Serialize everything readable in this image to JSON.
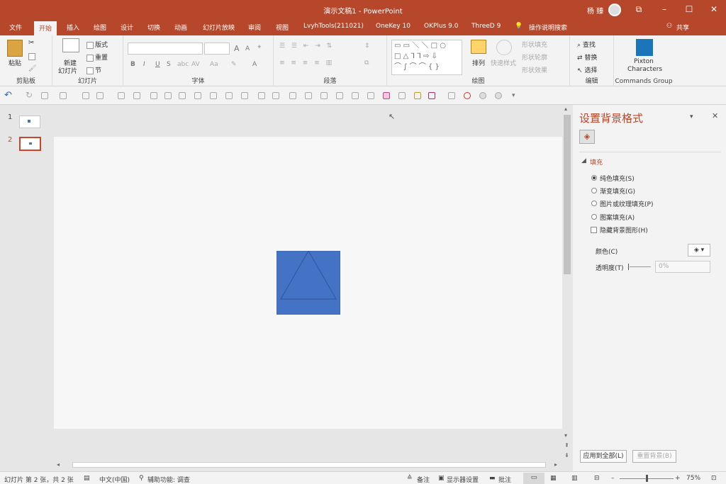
{
  "window": {
    "title": "演示文稿1 - PowerPoint",
    "user": "杨 臻",
    "min": "–",
    "max": "☐",
    "close": "✕",
    "ribbon_display": "⧉"
  },
  "tabs": [
    "文件",
    "开始",
    "插入",
    "绘图",
    "设计",
    "切换",
    "动画",
    "幻灯片放映",
    "审阅",
    "视图",
    "LvyhTools(211021)",
    "OneKey 10",
    "OKPlus 9.0",
    "ThreeD 9",
    "操作说明搜索"
  ],
  "share": "共享",
  "ribbon": {
    "clipboard": {
      "paste": "粘贴",
      "label": "剪贴板"
    },
    "slides": {
      "new_slide_1": "新建",
      "new_slide_2": "幻灯片",
      "layout": "版式",
      "reset": "重置",
      "section": "节",
      "label": "幻灯片"
    },
    "font": {
      "label": "字体",
      "grow": "A",
      "shrink": "A",
      "bold": "B",
      "italic": "I",
      "underline": "U",
      "strike": "S",
      "spacing": "abc",
      "case": "Aa",
      "color": "A"
    },
    "paragraph": {
      "label": "段落"
    },
    "drawing": {
      "arrange": "排列",
      "quick_styles": "快速样式",
      "shape_fill": "形状填充",
      "shape_outline": "形状轮廓",
      "shape_effects": "形状效果",
      "label": "绘图"
    },
    "editing": {
      "find": "查找",
      "replace": "替换",
      "select": "选择",
      "label": "编辑"
    },
    "commands": {
      "line1": "Pixton",
      "line2": "Characters",
      "label": "Commands Group"
    }
  },
  "thumbs": [
    {
      "num": "1"
    },
    {
      "num": "2"
    }
  ],
  "pane": {
    "title": "设置背景格式",
    "section": "填充",
    "options": [
      "纯色填充(S)",
      "渐变填充(G)",
      "图片或纹理填充(P)",
      "图案填充(A)"
    ],
    "selected": "纯色填充(S)",
    "hide_bg": "隐藏背景图形(H)",
    "color_label": "颜色(C)",
    "transparency_label": "透明度(T)",
    "transparency": "0%",
    "apply_all": "应用到全部(L)",
    "reset_bg": "重置背景(B)"
  },
  "status": {
    "slide_info": "幻灯片 第 2 张，共 2 张",
    "language": "中文(中国)",
    "accessibility": "辅助功能: 调查",
    "notes": "备注",
    "display": "显示器设置",
    "comments": "批注",
    "zoom_minus": "–",
    "zoom_plus": "+",
    "zoom": "75%",
    "zoom_fraction": 0.5
  },
  "colors": {
    "accent": "#b7472a",
    "shape_fill": "#4472c4",
    "shape_stroke": "#2f5597"
  }
}
